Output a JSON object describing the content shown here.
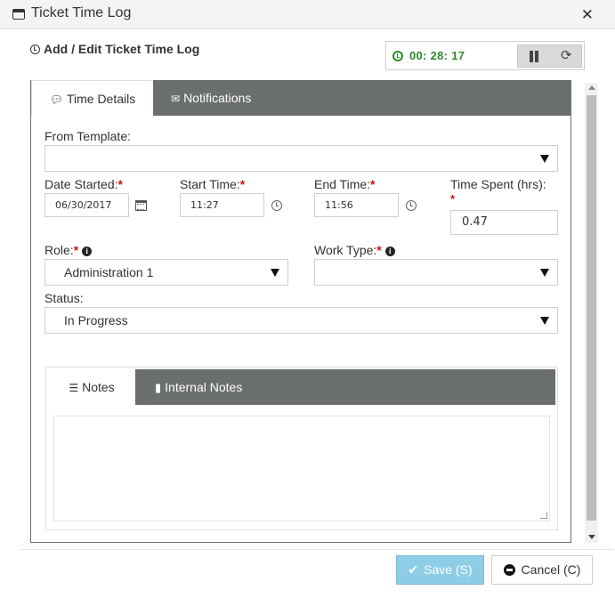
{
  "window": {
    "title": "Ticket Time Log"
  },
  "header": {
    "title": "Add / Edit Ticket Time Log"
  },
  "timer": {
    "value": "00: 28: 17"
  },
  "tabs": [
    {
      "label": "Time Details"
    },
    {
      "label": "Notifications"
    }
  ],
  "form": {
    "from_template": {
      "label": "From Template:",
      "value": ""
    },
    "date_started": {
      "label": "Date Started:",
      "value": "06/30/2017"
    },
    "start_time": {
      "label": "Start Time:",
      "value": "11:27"
    },
    "end_time": {
      "label": "End Time:",
      "value": "11:56"
    },
    "time_spent": {
      "label": "Time Spent (hrs):",
      "value": "0.47"
    },
    "role": {
      "label": "Role:",
      "value": "Administration 1"
    },
    "work_type": {
      "label": "Work Type:",
      "value": ""
    },
    "status": {
      "label": "Status:",
      "value": "In Progress"
    },
    "required_mark": "*"
  },
  "notes_tabs": [
    {
      "label": "Notes"
    },
    {
      "label": "Internal Notes"
    }
  ],
  "notes": {
    "value": ""
  },
  "footer": {
    "save_label": "Save (S)",
    "cancel_label": "Cancel (C)"
  }
}
